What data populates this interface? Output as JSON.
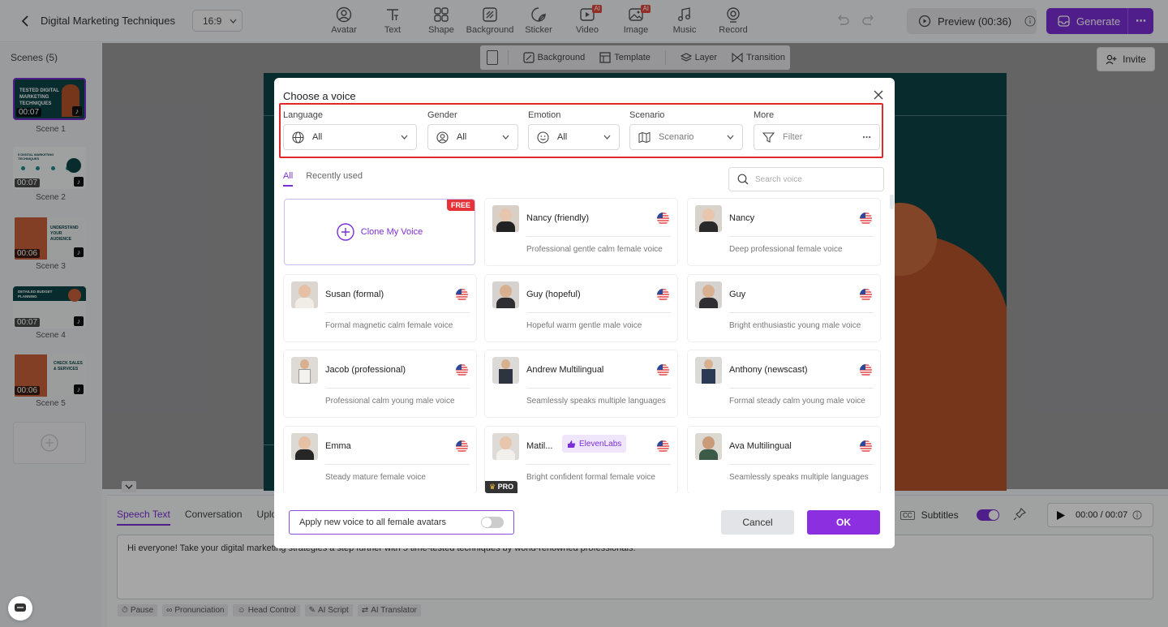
{
  "header": {
    "project_title": "Digital Marketing Techniques",
    "aspect_ratio": "16:9",
    "tools": [
      {
        "label": "Avatar",
        "icon": "avatar-icon",
        "ai": false
      },
      {
        "label": "Text",
        "icon": "text-icon",
        "ai": false
      },
      {
        "label": "Shape",
        "icon": "shape-icon",
        "ai": false
      },
      {
        "label": "Background",
        "icon": "background-icon",
        "ai": false
      },
      {
        "label": "Sticker",
        "icon": "sticker-icon",
        "ai": false
      },
      {
        "label": "Video",
        "icon": "video-icon",
        "ai": true
      },
      {
        "label": "Image",
        "icon": "image-icon",
        "ai": true
      },
      {
        "label": "Music",
        "icon": "music-icon",
        "ai": false
      },
      {
        "label": "Record",
        "icon": "record-icon",
        "ai": false
      }
    ],
    "ai_badge": "AI",
    "preview_label": "Preview (00:36)",
    "generate_label": "Generate"
  },
  "sidebar": {
    "title": "Scenes (5)",
    "scenes": [
      {
        "label": "Scene 1",
        "duration": "00:07",
        "thumb_text": "TESTED DIGITAL MARKETING TECHNIQUES"
      },
      {
        "label": "Scene 2",
        "duration": "00:07",
        "thumb_text": "5 DIGITAL MARKETING TECHNIQUES"
      },
      {
        "label": "Scene 3",
        "duration": "00:06",
        "thumb_text": "UNDERSTAND YOUR AUDIENCE"
      },
      {
        "label": "Scene 4",
        "duration": "00:07",
        "thumb_text": "DETAILED BUDGET PLANNING"
      },
      {
        "label": "Scene 5",
        "duration": "00:06",
        "thumb_text": "CHECK SALES & SERVICES"
      }
    ]
  },
  "canvas_toolbar": {
    "background": "Background",
    "template": "Template",
    "layer": "Layer",
    "transition": "Transition"
  },
  "invite_label": "Invite",
  "bottom_panel": {
    "tabs": [
      "Speech Text",
      "Conversation",
      "Upload"
    ],
    "script_text": "Hi everyone! Take your digital marketing strategies a step further with 5 time-tested techniques by world-renowned professionals.",
    "chips": [
      "Pause",
      "Pronunciation",
      "Head Control",
      "AI Script",
      "AI Translator"
    ],
    "subtitles_label": "Subtitles",
    "time": "00:00 / 00:07"
  },
  "modal": {
    "title": "Choose a voice",
    "filters": {
      "language": {
        "label": "Language",
        "value": "All"
      },
      "gender": {
        "label": "Gender",
        "value": "All"
      },
      "emotion": {
        "label": "Emotion",
        "value": "All"
      },
      "scenario": {
        "label": "Scenario",
        "placeholder": "Scenario"
      },
      "more": {
        "label": "More",
        "placeholder": "Filter"
      }
    },
    "tabs": [
      "All",
      "Recently used"
    ],
    "search_placeholder": "Search voice",
    "clone": {
      "label": "Clone My Voice",
      "badge": "FREE"
    },
    "voices": [
      {
        "name": "Nancy (friendly)",
        "desc": "Professional gentle calm female voice"
      },
      {
        "name": "Nancy",
        "desc": "Deep professional female voice"
      },
      {
        "name": "Susan (formal)",
        "desc": "Formal magnetic calm female voice"
      },
      {
        "name": "Guy (hopeful)",
        "desc": "Hopeful warm gentle male voice"
      },
      {
        "name": "Guy",
        "desc": "Bright enthusiastic young male voice"
      },
      {
        "name": "Jacob (professional)",
        "desc": "Professional calm young male voice"
      },
      {
        "name": "Andrew Multilingual",
        "desc": "Seamlessly speaks multiple languages"
      },
      {
        "name": "Anthony (newscast)",
        "desc": "Formal steady calm young male voice"
      },
      {
        "name": "Emma",
        "desc": "Steady mature female voice"
      },
      {
        "name": "Matil...",
        "desc": "Bright confident formal female voice",
        "badge": "ElevenLabs",
        "pro": "PRO"
      },
      {
        "name": "Ava Multilingual",
        "desc": "Seamlessly speaks multiple languages"
      }
    ],
    "apply_label": "Apply new voice to all female avatars",
    "cancel_label": "Cancel",
    "ok_label": "OK"
  },
  "colors": {
    "accent": "#7a2fd6",
    "highlight_frame": "#e0292a",
    "stage_bg": "#0d4447"
  }
}
